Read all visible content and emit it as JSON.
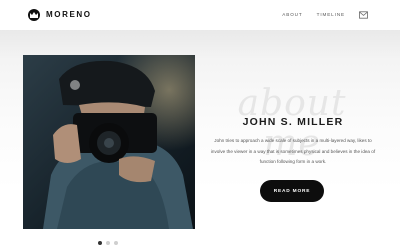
{
  "header": {
    "brand": "MORENO",
    "nav": [
      {
        "label": "ABOUT"
      },
      {
        "label": "TIMELINE"
      }
    ],
    "mail_icon": "envelope-icon",
    "logo_icon": "crown-icon"
  },
  "about": {
    "script_word": "about me",
    "name": "JOHN S. MILLER",
    "bio": "John tries to approach a wide scale of subjects in a multi-layered way, likes to involve the viewer in a way that is sometimes physical and believes in the idea of function following form in a work.",
    "button_label": "READ MORE"
  },
  "carousel": {
    "slides_count": 3,
    "active_index": 0
  },
  "colors": {
    "button_bg": "#0d0d0d",
    "text_dark": "#1b1b1b",
    "text_muted": "#555555"
  }
}
